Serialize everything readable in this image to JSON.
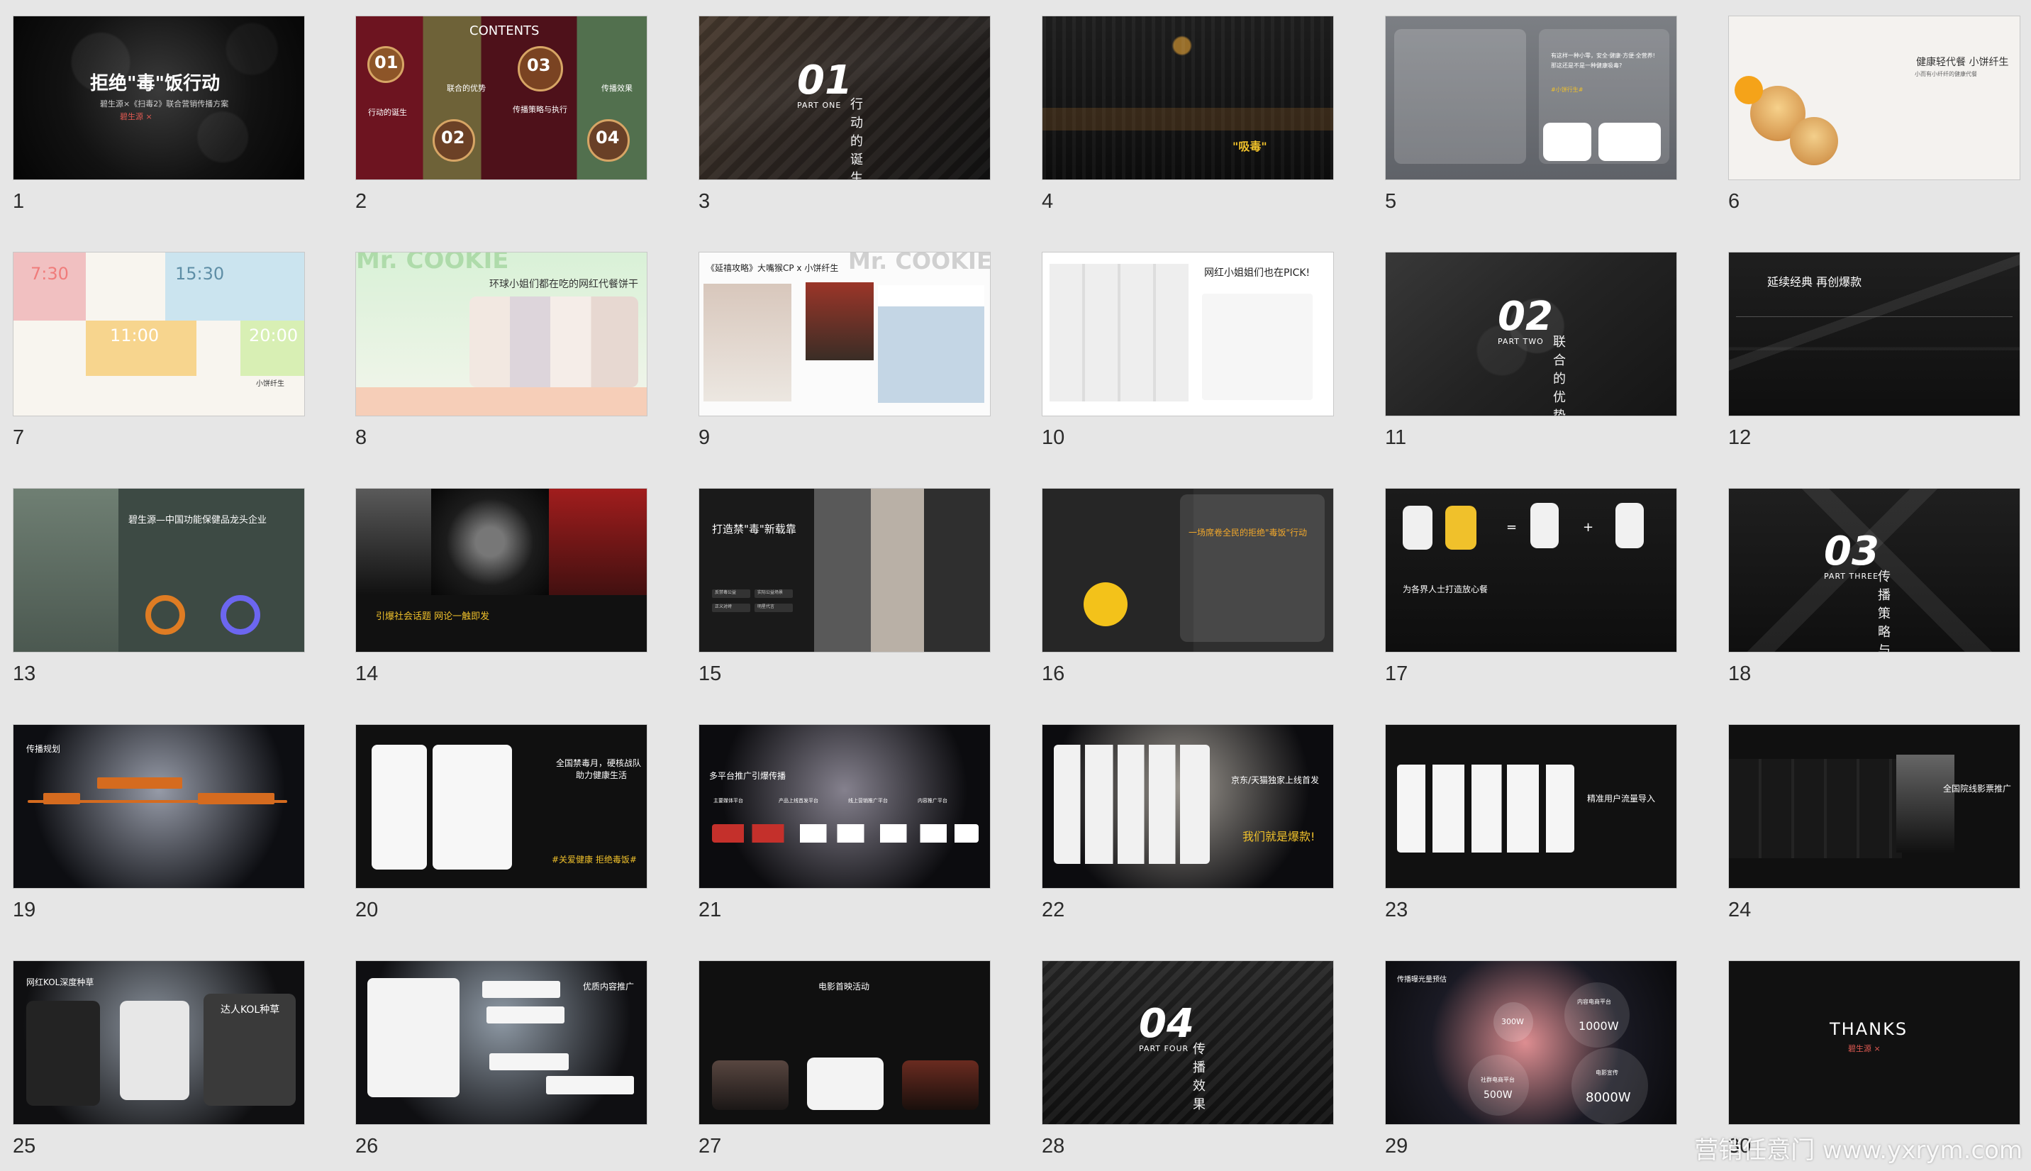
{
  "thumbnails": [
    {
      "number": "1",
      "title": "拒绝\"毒\"饭行动",
      "subtitle": "碧生源×《扫毒2》联合营销传播方案",
      "brand": "碧生源 ×"
    },
    {
      "number": "2",
      "contents_title": "CONTENTS",
      "items": [
        {
          "no": "01",
          "label": "行动的诞生"
        },
        {
          "no": "02",
          "label": "联合的优势"
        },
        {
          "no": "03",
          "label": "传播策略与执行"
        },
        {
          "no": "04",
          "label": "传播效果"
        }
      ]
    },
    {
      "number": "3",
      "part_no": "01",
      "part_en": "PART ONE",
      "part_label": "行动的诞生"
    },
    {
      "number": "4",
      "highlight": "\"吸毒\""
    },
    {
      "number": "5",
      "headline": "有这样一种小零，安全·健康·方便·全营养!",
      "sub": "那这还是不是一种健康吸毒?",
      "hashtag": "#小饼行生#"
    },
    {
      "number": "6",
      "title": "健康轻代餐 小饼纤生",
      "sub": "小而有小纤纤的健康代餐"
    },
    {
      "number": "7",
      "times": [
        "7:30",
        "15:30",
        "11:00",
        "20:00"
      ],
      "brand": "小饼纤生"
    },
    {
      "number": "8",
      "brand_bg": "Mr. COOKIE",
      "title": "环球小姐们都在吃的网红代餐饼干"
    },
    {
      "number": "9",
      "title": "《延禧攻略》大嘴猴CP x 小饼纤生",
      "brand_bg": "Mr. COOKIE"
    },
    {
      "number": "10",
      "title": "网红小姐姐们也在PICK!"
    },
    {
      "number": "11",
      "part_no": "02",
      "part_en": "PART TWO",
      "part_label": "联合的优势"
    },
    {
      "number": "12",
      "title": "延续经典 再创爆款"
    },
    {
      "number": "13",
      "title": "碧生源—中国功能保健品龙头企业"
    },
    {
      "number": "14",
      "title": "引爆社会话题 网论一触即发"
    },
    {
      "number": "15",
      "title": "打造禁\"毒\"新载靠",
      "tags": [
        "反禁毒公益",
        "实际公益场景",
        "正义对峙",
        "明星代言"
      ]
    },
    {
      "number": "16",
      "title": "一场席卷全民的拒绝\"毒饭\"行动"
    },
    {
      "number": "17",
      "title": "为各界人士打造放心餐",
      "ops": [
        "=",
        "+"
      ]
    },
    {
      "number": "18",
      "part_no": "03",
      "part_en": "PART THREE",
      "part_label": "传播策略与执行"
    },
    {
      "number": "19",
      "title": "传播规划"
    },
    {
      "number": "20",
      "title": "全国禁毒月，硬核战队",
      "sub": "助力健康生活",
      "hashtag": "#关爱健康 拒绝毒饭#"
    },
    {
      "number": "21",
      "title": "多平台推广引爆传播",
      "platforms": [
        "主要媒体平台",
        "产品上线首发平台",
        "线上营销推广平台",
        "内容推广平台"
      ]
    },
    {
      "number": "22",
      "title": "京东/天猫独家上线首发",
      "slogan": "我们就是爆款!"
    },
    {
      "number": "23",
      "title": "精准用户流量导入"
    },
    {
      "number": "24",
      "title": "全国院线影票推广"
    },
    {
      "number": "25",
      "title": "网红KOL深度种草",
      "panel_title": "达人KOL种草"
    },
    {
      "number": "26",
      "title": "优质内容推广"
    },
    {
      "number": "27",
      "title": "电影首映活动"
    },
    {
      "number": "28",
      "part_no": "04",
      "part_en": "PART FOUR",
      "part_label": "传播效果"
    },
    {
      "number": "29",
      "title": "传播曝光量预估",
      "bubbles": [
        {
          "label": "内容电商平台",
          "value": "1000W"
        },
        {
          "label": "电影宣传",
          "value": "8000W"
        },
        {
          "label": "社群电商平台",
          "value": "500W"
        },
        {
          "label": "",
          "value": "300W"
        }
      ]
    },
    {
      "number": "30",
      "title": "THANKS",
      "brand": "碧生源 ×"
    }
  ],
  "watermark": "营销任意门 www.yxrym.com",
  "colors": {
    "accent": "#f0c12b",
    "dark_panel": "#1b1b1b",
    "orange": "#d56b1f",
    "red": "#c4302b"
  }
}
